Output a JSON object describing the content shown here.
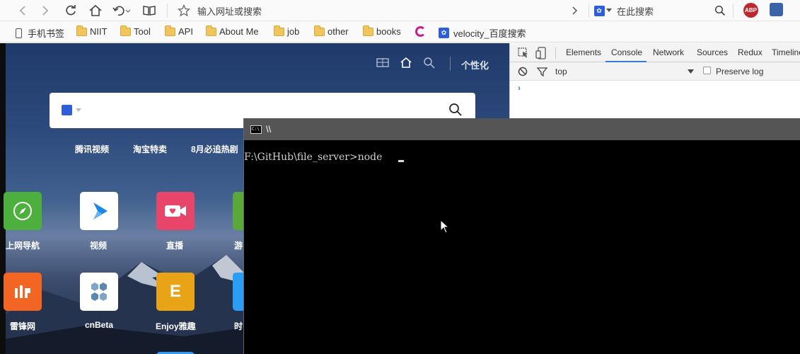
{
  "browser": {
    "address_placeholder": "输入网址或搜索",
    "search_placeholder": "在此搜索",
    "abp_label": "ABP"
  },
  "bookmarks": [
    {
      "label": "手机书签",
      "icon": "phone-icon"
    },
    {
      "label": "NIIT",
      "icon": "folder-icon"
    },
    {
      "label": "Tool",
      "icon": "folder-icon"
    },
    {
      "label": "API",
      "icon": "folder-icon"
    },
    {
      "label": "About Me",
      "icon": "folder-icon"
    },
    {
      "label": "job",
      "icon": "folder-icon"
    },
    {
      "label": "other",
      "icon": "folder-icon"
    },
    {
      "label": "books",
      "icon": "folder-icon"
    },
    {
      "label": "",
      "icon": "swirl-icon"
    },
    {
      "label": "velocity_百度搜索",
      "icon": "baidu-paw-icon"
    }
  ],
  "newtab": {
    "personalize_label": "个性化",
    "hot_links": [
      "腾讯视频",
      "淘宝特卖",
      "8月必追热剧"
    ],
    "tiles": [
      {
        "label": "上网导航",
        "color": "#4caf3e",
        "glyph": "compass"
      },
      {
        "label": "视频",
        "color": "#ffffff",
        "glyph": "play"
      },
      {
        "label": "直播",
        "color": "#e8456b",
        "glyph": "camera"
      },
      {
        "label": "游",
        "color": "#5aa83a",
        "glyph": "game"
      },
      {
        "label": "雷锋网",
        "color": "#f26522",
        "glyph": "lei"
      },
      {
        "label": "cnBeta",
        "color": "#ffffff",
        "glyph": "hex"
      },
      {
        "label": "Enjoy雅趣",
        "color": "#e8a317",
        "glyph": "E"
      },
      {
        "label": "时",
        "color": "#2a9df4",
        "glyph": "time"
      }
    ]
  },
  "devtools": {
    "tabs": [
      "Elements",
      "Console",
      "Network",
      "Sources",
      "Redux",
      "Timeline"
    ],
    "active_tab": "Console",
    "context": "top",
    "preserve_log_label": "Preserve log",
    "preserve_log_checked": false,
    "prompt": "›"
  },
  "cmd": {
    "title": "\\\\",
    "icon_text": "C:\\",
    "line": "F:\\GitHub\\file_server>node "
  }
}
